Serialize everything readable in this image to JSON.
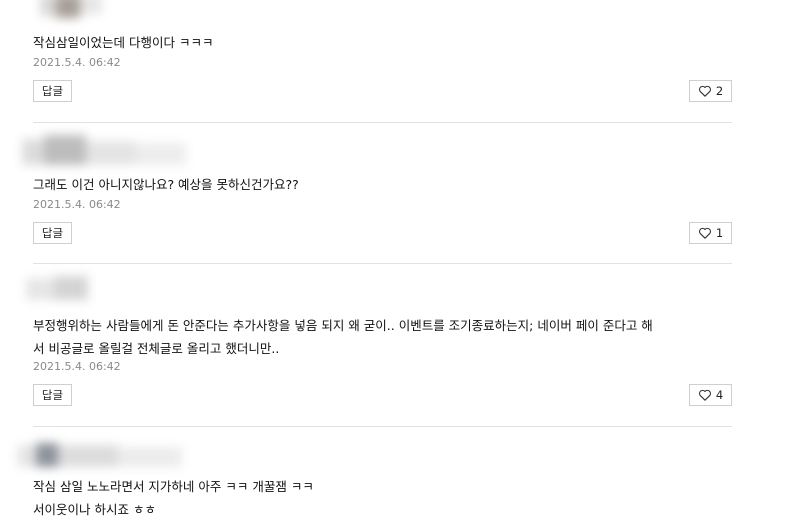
{
  "comments": [
    {
      "text": "작심삼일이었는데 다행이다 ㅋㅋㅋ",
      "date": "2021.5.4. 06:42",
      "reply_label": "답글",
      "likes": "2"
    },
    {
      "text": "그래도 이건 아니지않나요? 예상을 못하신건가요??",
      "date": "2021.5.4. 06:42",
      "reply_label": "답글",
      "likes": "1"
    },
    {
      "text_line1": "부정행위하는 사람들에게 돈 안준다는 추가사항을 넣음 되지 왜 굳이.. 이벤트를 조기종료하는지; 네이버 페이 준다고 해",
      "text_line2": "서 비공글로 올릴걸 전체글로 올리고 했더니만..",
      "date": "2021.5.4. 06:42",
      "reply_label": "답글",
      "likes": "4"
    },
    {
      "text_line1": "작심 삼일 노노라면서 지가하네 아주 ㅋㅋ 개꿀잼 ㅋㅋ",
      "text_line2": "서이웃이나 하시죠 ㅎㅎ"
    }
  ],
  "colors": {
    "divider": "#e2e2e2",
    "date": "#8a8a8a",
    "border": "#cfcfcf"
  },
  "icons": {
    "like": "heart-outline-icon"
  }
}
